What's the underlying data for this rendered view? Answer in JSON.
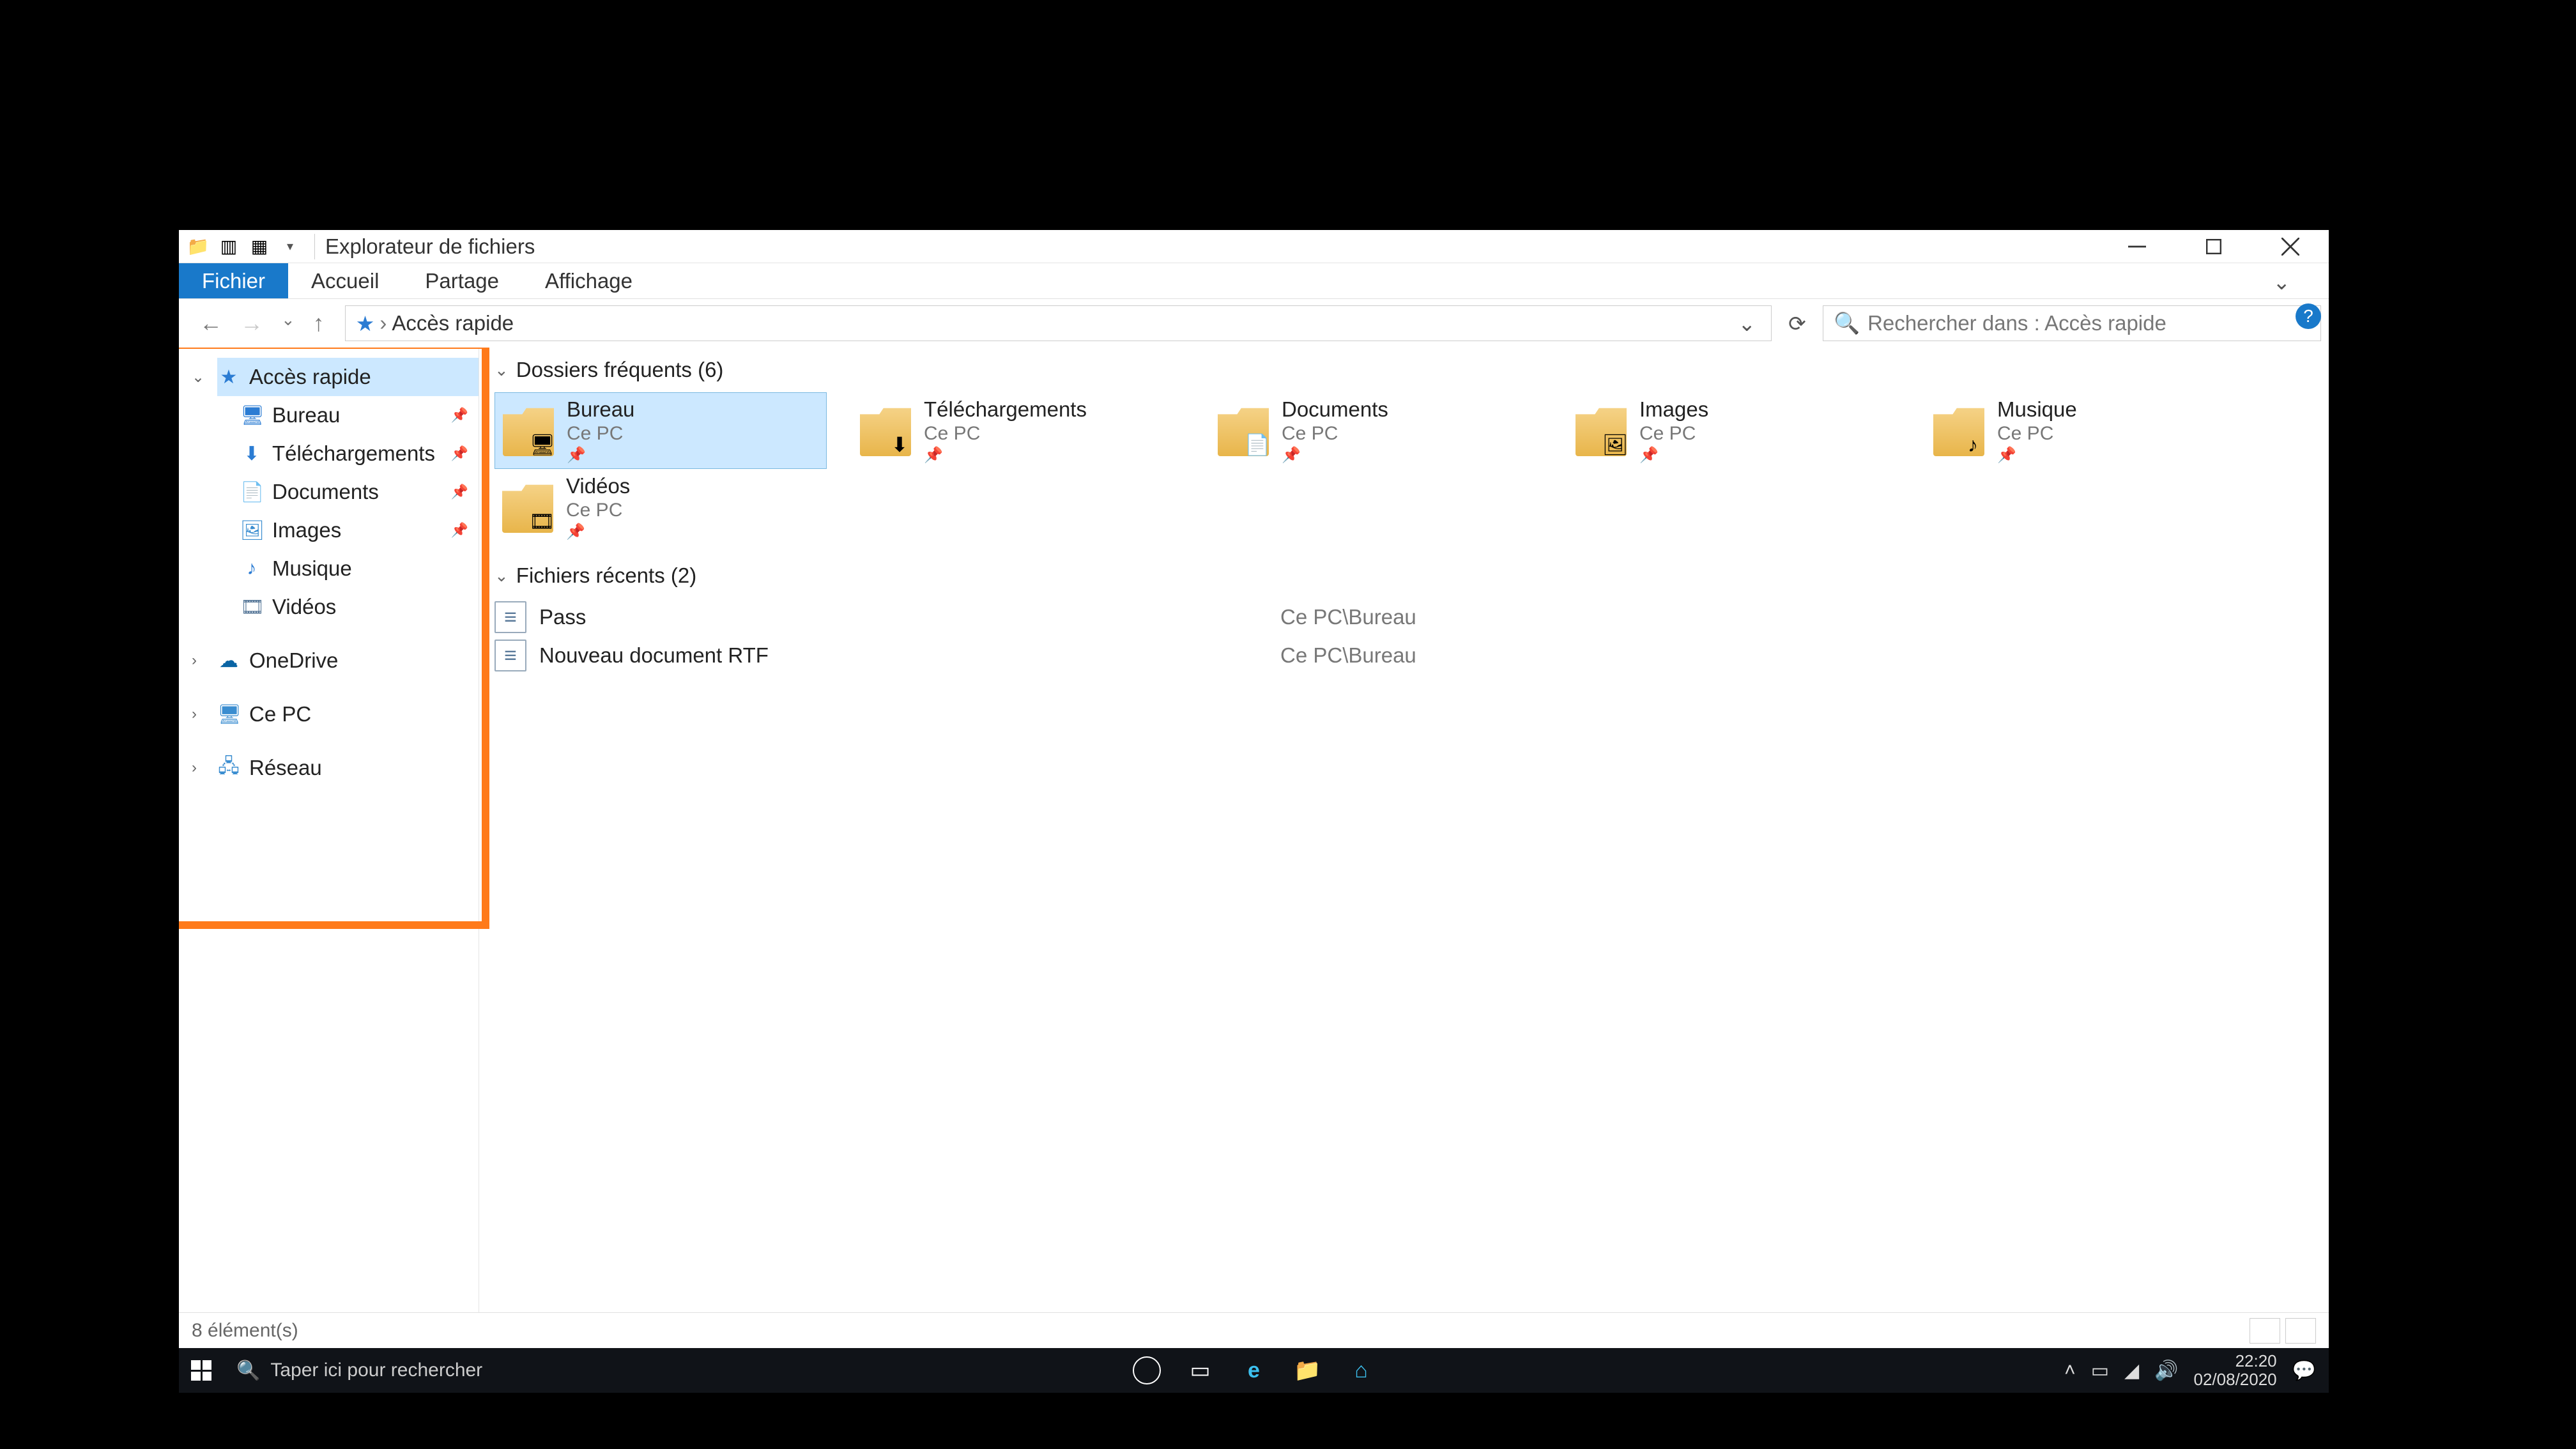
{
  "window": {
    "title": "Explorateur de fichiers",
    "tabs": {
      "file": "Fichier",
      "home": "Accueil",
      "share": "Partage",
      "view": "Affichage"
    }
  },
  "address": {
    "location": "Accès rapide",
    "search_placeholder": "Rechercher dans : Accès rapide"
  },
  "nav": {
    "quick_access": "Accès rapide",
    "items": [
      {
        "label": "Bureau",
        "pinned": true,
        "icon": "desk"
      },
      {
        "label": "Téléchargements",
        "pinned": true,
        "icon": "dl"
      },
      {
        "label": "Documents",
        "pinned": true,
        "icon": "doc"
      },
      {
        "label": "Images",
        "pinned": true,
        "icon": "img"
      },
      {
        "label": "Musique",
        "pinned": false,
        "icon": "mus"
      },
      {
        "label": "Vidéos",
        "pinned": false,
        "icon": "vid"
      }
    ],
    "onedrive": "OneDrive",
    "this_pc": "Ce PC",
    "network": "Réseau"
  },
  "content": {
    "frequent_header": "Dossiers fréquents (6)",
    "folders": [
      {
        "name": "Bureau",
        "sub": "Ce PC",
        "overlay": "desk",
        "selected": true
      },
      {
        "name": "Téléchargements",
        "sub": "Ce PC",
        "overlay": "dl",
        "selected": false
      },
      {
        "name": "Documents",
        "sub": "Ce PC",
        "overlay": "doc",
        "selected": false
      },
      {
        "name": "Images",
        "sub": "Ce PC",
        "overlay": "img",
        "selected": false
      },
      {
        "name": "Musique",
        "sub": "Ce PC",
        "overlay": "mus",
        "selected": false
      },
      {
        "name": "Vidéos",
        "sub": "Ce PC",
        "overlay": "vid",
        "selected": false
      }
    ],
    "recent_header": "Fichiers récents (2)",
    "recent": [
      {
        "name": "Pass",
        "path": "Ce PC\\Bureau"
      },
      {
        "name": "Nouveau document RTF",
        "path": "Ce PC\\Bureau"
      }
    ]
  },
  "status": {
    "count": "8 élément(s)"
  },
  "taskbar": {
    "search_placeholder": "Taper ici pour rechercher",
    "time": "22:20",
    "date": "02/08/2020"
  }
}
